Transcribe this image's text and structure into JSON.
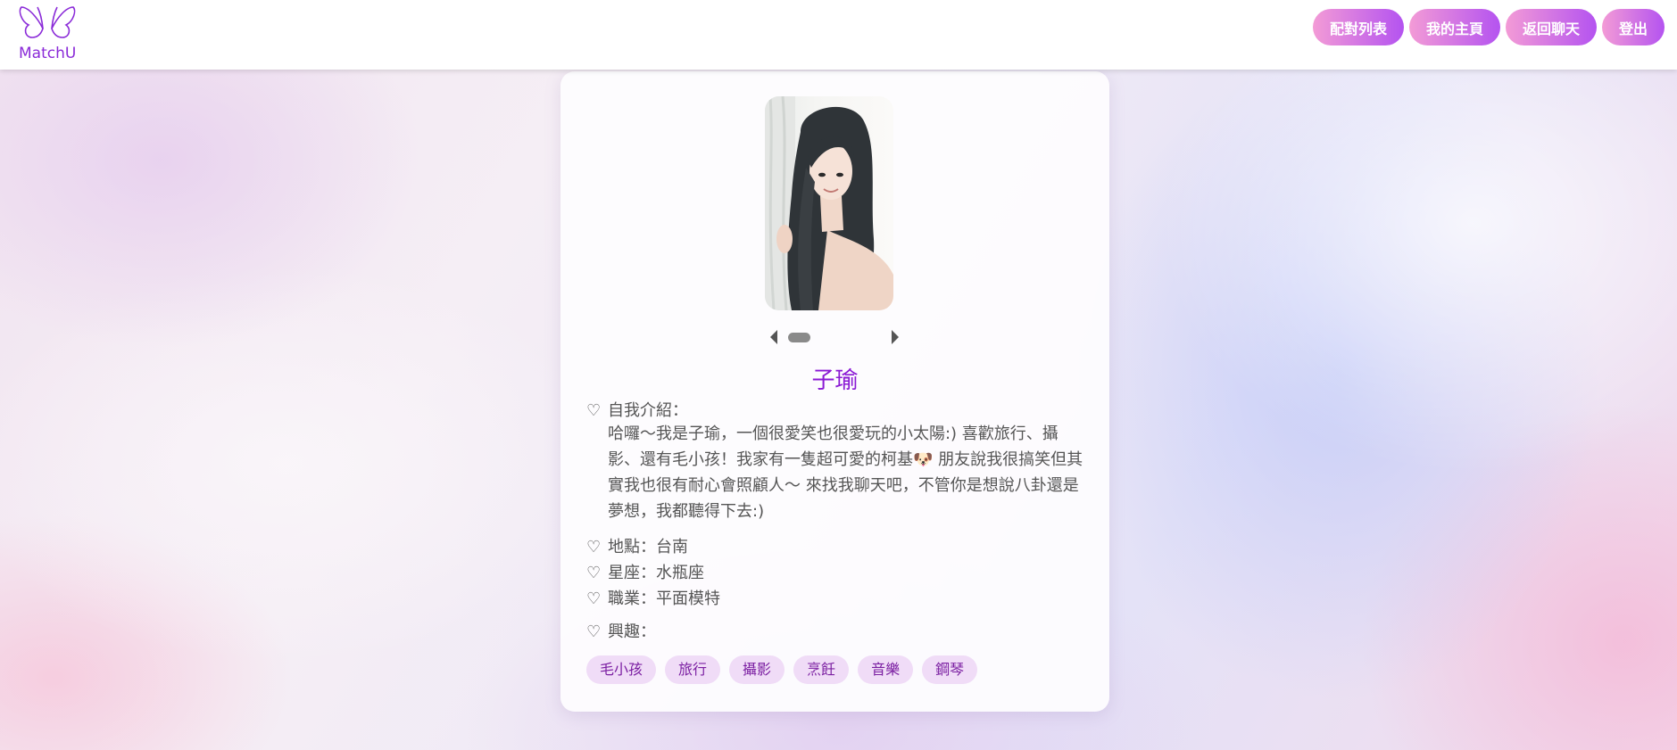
{
  "app": {
    "logo_text": "MatchU",
    "accent_color": "#8a2ad8"
  },
  "nav": {
    "buttons": [
      {
        "label": "配對列表"
      },
      {
        "label": "我的主頁"
      },
      {
        "label": "返回聊天"
      },
      {
        "label": "登出"
      }
    ]
  },
  "profile": {
    "name": "子瑜",
    "photo_count": 1,
    "current_photo": 1,
    "intro_label": "自我介紹：",
    "intro_text": "哈囉～我是子瑜，一個很愛笑也很愛玩的小太陽:) 喜歡旅行、攝影、還有毛小孩！我家有一隻超可愛的柯基🐶 朋友說我很搞笑但其實我也很有耐心會照顧人～ 來找我聊天吧，不管你是想說八卦還是夢想，我都聽得下去:)",
    "location_label": "地點：",
    "location": "台南",
    "zodiac_label": "星座：",
    "zodiac": "水瓶座",
    "job_label": "職業：",
    "job": "平面模特",
    "interests_label": "興趣：",
    "heart_symbol": "♡",
    "interests": [
      "毛小孩",
      "旅行",
      "攝影",
      "烹飪",
      "音樂",
      "鋼琴"
    ]
  }
}
